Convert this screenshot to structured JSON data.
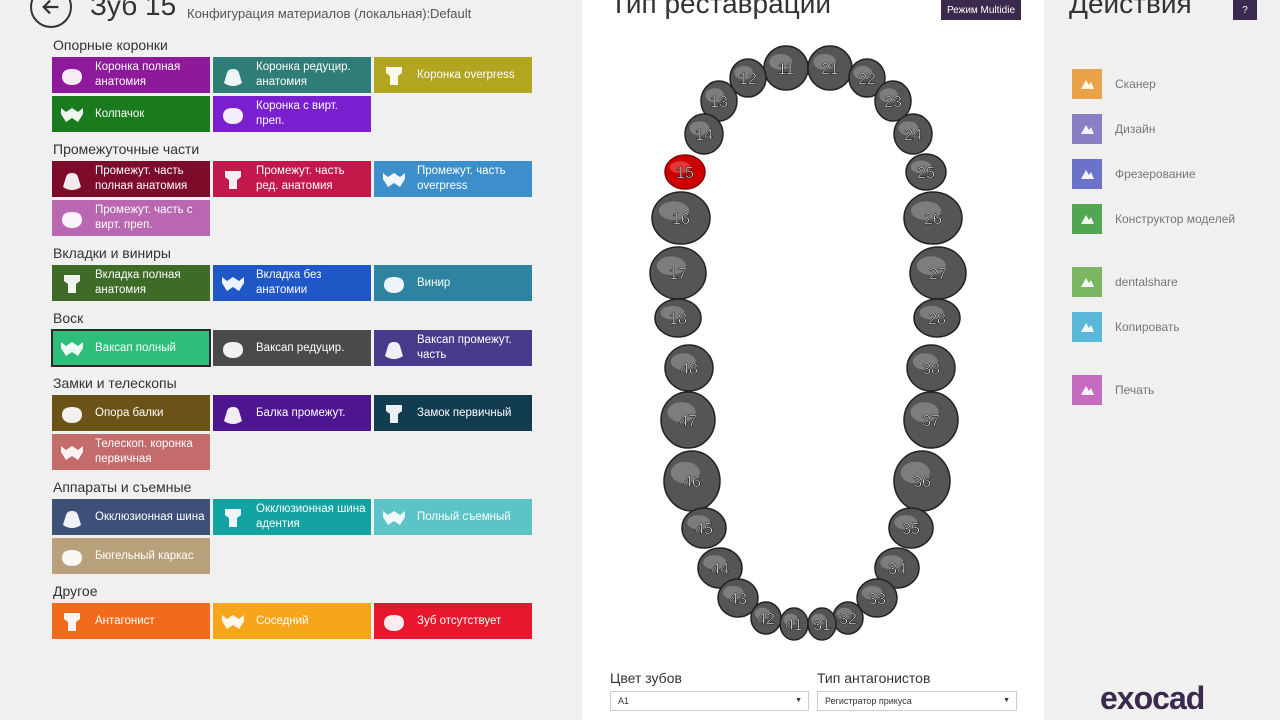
{
  "header": {
    "title": "Зуб 15",
    "config_label": "Конфигурация материалов (локальная):",
    "config_value": "Default"
  },
  "sections": [
    {
      "title": "Опорные коронки",
      "tiles": [
        {
          "label": "Коронка полная анатомия",
          "color": "#8e1a9b",
          "icon": "crown-full-icon"
        },
        {
          "label": "Коронка редуцир. анатомия",
          "color": "#2e7d76",
          "icon": "crown-reduced-icon"
        },
        {
          "label": "Коронка overpress",
          "color": "#b2a51f",
          "icon": "crown-overpress-icon"
        },
        {
          "label": "Колпачок",
          "color": "#1a7a1e",
          "icon": "coping-icon"
        },
        {
          "label": "Коронка с вирт. преп.",
          "color": "#7a1fd0",
          "icon": "crown-virtual-prep-icon"
        }
      ]
    },
    {
      "title": "Промежуточные части",
      "tiles": [
        {
          "label": "Промежут. часть полная анатомия",
          "color": "#7d0b2a",
          "icon": "pontic-full-icon"
        },
        {
          "label": "Промежут. часть ред. анатомия",
          "color": "#c2194a",
          "icon": "pontic-reduced-icon"
        },
        {
          "label": "Промежут. часть overpress",
          "color": "#3d8fcc",
          "icon": "pontic-overpress-icon"
        },
        {
          "label": "Промежут. часть с вирт. преп.",
          "color": "#b867b0",
          "icon": "pontic-virtual-prep-icon"
        }
      ]
    },
    {
      "title": "Вкладки и виниры",
      "tiles": [
        {
          "label": "Вкладка полная анатомия",
          "color": "#3e6b25",
          "icon": "inlay-full-icon"
        },
        {
          "label": "Вкладка без анатомии",
          "color": "#1f57c7",
          "icon": "inlay-no-anatomy-icon"
        },
        {
          "label": "Винир",
          "color": "#2e84a0",
          "icon": "veneer-icon"
        }
      ]
    },
    {
      "title": "Воск",
      "tiles": [
        {
          "label": "Ваксап полный",
          "color": "#2ebe7a",
          "icon": "waxup-full-icon"
        },
        {
          "label": "Ваксап редуцир.",
          "color": "#4a4a4a",
          "icon": "waxup-reduced-icon"
        },
        {
          "label": "Ваксап промежут. часть",
          "color": "#4a3a8c",
          "icon": "waxup-pontic-icon"
        }
      ]
    },
    {
      "title": "Замки и телескопы",
      "tiles": [
        {
          "label": "Опора балки",
          "color": "#6b5317",
          "icon": "bar-abutment-icon"
        },
        {
          "label": "Балка промежут.",
          "color": "#4e1591",
          "icon": "bar-pontic-icon"
        },
        {
          "label": "Замок первичный",
          "color": "#123c4f",
          "icon": "attachment-primary-icon"
        },
        {
          "label": "Телескоп. коронка первичная",
          "color": "#c46b6b",
          "icon": "telescope-crown-icon"
        }
      ]
    },
    {
      "title": "Аппараты и съемные",
      "tiles": [
        {
          "label": "Окклюзионная шина",
          "color": "#3d5078",
          "icon": "splint-icon"
        },
        {
          "label": "Окклюзионная шина адентия",
          "color": "#14a3a3",
          "icon": "splint-edentulous-icon"
        },
        {
          "label": "Полный съемный",
          "color": "#5cc4c9",
          "icon": "full-denture-icon"
        },
        {
          "label": "Бюгельный каркас",
          "color": "#b8a07a",
          "icon": "partial-framework-icon"
        }
      ]
    },
    {
      "title": "Другое",
      "tiles": [
        {
          "label": "Антагонист",
          "color": "#f26a1b",
          "icon": "antagonist-icon"
        },
        {
          "label": "Соседний",
          "color": "#f7a51b",
          "icon": "adjacent-icon"
        },
        {
          "label": "Зуб отсутствует",
          "color": "#e8172d",
          "icon": "missing-tooth-icon"
        }
      ]
    }
  ],
  "center": {
    "title": "Тип реставрации",
    "multidie_label": "Режим Multidie",
    "selected_tooth": "15",
    "selected_color": "#cc0000",
    "tooth_color": "#555555",
    "teeth": [
      "11",
      "21",
      "12",
      "22",
      "13",
      "23",
      "14",
      "24",
      "15",
      "25",
      "16",
      "26",
      "17",
      "27",
      "18",
      "28",
      "48",
      "38",
      "47",
      "37",
      "46",
      "36",
      "45",
      "35",
      "44",
      "34",
      "43",
      "33",
      "42",
      "32",
      "41",
      "31"
    ],
    "shade_label": "Цвет зубов",
    "shade_value": "A1",
    "antagonist_label": "Тип антагонистов",
    "antagonist_value": "Регистратор прикуса"
  },
  "actions": {
    "title": "Действия",
    "help_label": "?",
    "items": [
      {
        "label": "Сканер",
        "color": "#e8a34a",
        "icon": "scanner-icon"
      },
      {
        "label": "Дизайн",
        "color": "#8a7fc4",
        "icon": "design-icon"
      },
      {
        "label": "Фрезерование",
        "color": "#6c71c9",
        "icon": "milling-icon"
      },
      {
        "label": "Конструктор моделей",
        "color": "#52a652",
        "icon": "model-creator-icon"
      },
      {
        "label": "dentalshare",
        "color": "#7bb662",
        "icon": "dentalshare-icon"
      },
      {
        "label": "Копировать",
        "color": "#5cb8d9",
        "icon": "copy-icon"
      },
      {
        "label": "Печать",
        "color": "#c46bc0",
        "icon": "print-icon"
      }
    ]
  },
  "brand": {
    "logo_text": "exocad"
  }
}
